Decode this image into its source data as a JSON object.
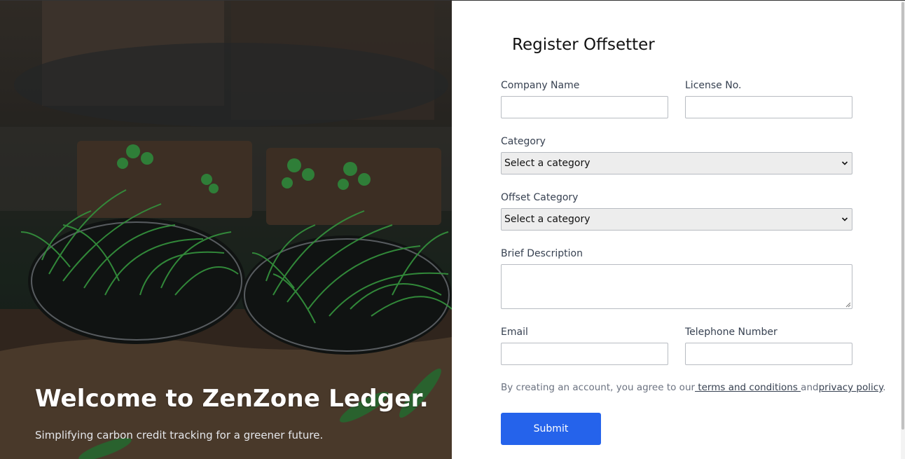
{
  "hero": {
    "title": "Welcome to ZenZone Ledger.",
    "subtitle": "Simplifying carbon credit tracking for a greener future."
  },
  "form": {
    "title": "Register Offsetter",
    "company_name_label": "Company Name",
    "company_name_value": "",
    "license_label": "License No.",
    "license_value": "",
    "category_label": "Category",
    "category_selected": "Select a category",
    "offset_category_label": "Offset Category",
    "offset_category_selected": "Select a category",
    "description_label": "Brief Description",
    "description_value": "",
    "email_label": "Email",
    "email_value": "",
    "phone_label": "Telephone Number",
    "phone_value": "",
    "terms_prefix": "By creating an account, you agree to our",
    "terms_link": " terms and conditions ",
    "terms_and": "and",
    "privacy_link": "privacy policy",
    "terms_suffix": ".",
    "submit_label": "Submit"
  },
  "colors": {
    "accent": "#2563eb",
    "select_bg": "#ededed",
    "input_border": "#b8bcc2"
  },
  "icons": {
    "select_arrow": "chevron-down-icon",
    "textarea_resize": "resize-grip-icon"
  }
}
